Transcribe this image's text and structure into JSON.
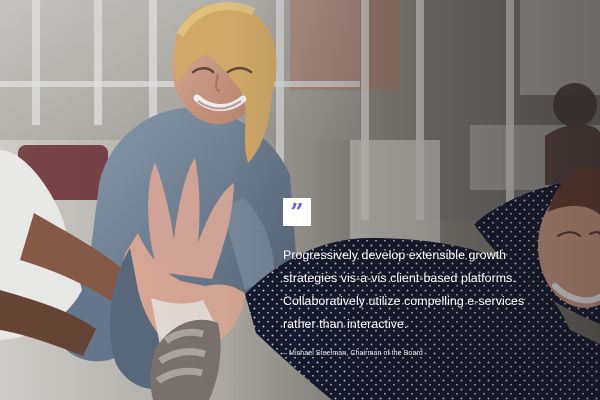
{
  "testimonial": {
    "quote_icon": "quote-mark-icon",
    "text": "Progressively develop extensible growth strategies vis-a-vis client-based platforms. Collaboratively utilize compelling e-services rather than interactive.",
    "author": "– Michael Steelman, Chairman of the Board"
  },
  "colors": {
    "accent": "#6c5cff",
    "text": "#ffffff"
  }
}
